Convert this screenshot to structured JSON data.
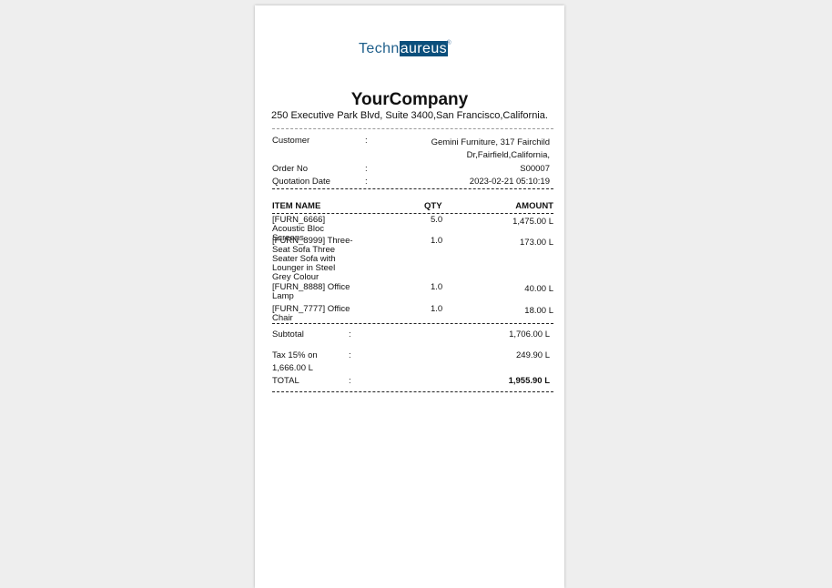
{
  "logo": {
    "part1": "Techn",
    "part2": "aureus",
    "mark": "®"
  },
  "company": {
    "name": "YourCompany",
    "address": "250 Executive Park Blvd, Suite 3400,San Francisco,California."
  },
  "info": {
    "customer_label": "Customer",
    "customer_line1": "Gemini Furniture, 317 Fairchild",
    "customer_line2": "Dr,Fairfield,California,",
    "order_label": "Order No",
    "order_value": "S00007",
    "date_label": "Quotation Date",
    "date_value": "2023-02-21 05:10:19",
    "separator": ":"
  },
  "table": {
    "headers": {
      "item": "ITEM NAME",
      "qty": "QTY",
      "amount": "AMOUNT"
    },
    "rows": [
      {
        "name": "[FURN_6666] Acoustic Bloc Screens",
        "qty": "5.0",
        "amount": "1,475.00 L"
      },
      {
        "name": "[FURN_8999] Three-Seat Sofa Three Seater Sofa with Lounger in Steel Grey Colour",
        "qty": "1.0",
        "amount": "173.00 L"
      },
      {
        "name": "[FURN_8888] Office Lamp",
        "qty": "1.0",
        "amount": "40.00 L"
      },
      {
        "name": "[FURN_7777] Office Chair",
        "qty": "1.0",
        "amount": "18.00 L"
      }
    ]
  },
  "totals": {
    "subtotal_label": "Subtotal",
    "subtotal_value": "1,706.00 L",
    "tax_label_line1": "Tax 15% on",
    "tax_label_line2": "1,666.00 L",
    "tax_value": "249.90 L",
    "total_label": "TOTAL",
    "total_value": "1,955.90 L"
  }
}
